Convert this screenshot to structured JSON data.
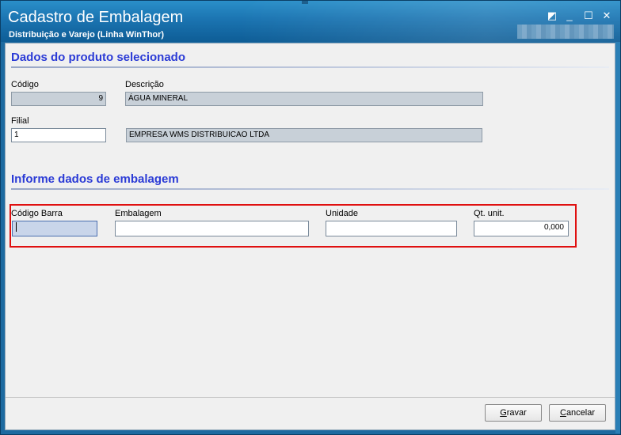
{
  "window": {
    "title": "Cadastro de Embalagem",
    "subtitle": "Distribuição e Varejo (Linha WinThor)",
    "controls": {
      "restore": "◩",
      "minimize": "_",
      "maximize": "☐",
      "close": "✕"
    }
  },
  "produto": {
    "section_title": "Dados do produto selecionado",
    "codigo": {
      "label": "Código",
      "value": "9"
    },
    "descricao": {
      "label": "Descrição",
      "value": "ÁGUA MINERAL"
    },
    "filial": {
      "label": "Filial",
      "value": "1",
      "name": "EMPRESA WMS DISTRIBUICAO LTDA"
    }
  },
  "embalagem": {
    "section_title": "Informe dados de embalagem",
    "codigo_barra": {
      "label": "Código Barra",
      "value": ""
    },
    "embalagem": {
      "label": "Embalagem",
      "value": ""
    },
    "unidade": {
      "label": "Unidade",
      "value": ""
    },
    "qt_unit": {
      "label": "Qt. unit.",
      "value": "0,000"
    }
  },
  "buttons": {
    "gravar_first": "G",
    "gravar_rest": "ravar",
    "cancelar_first": "C",
    "cancelar_rest": "ancelar"
  },
  "colors": {
    "section_title": "#2b3bd6",
    "highlight": "#e01010",
    "titlebar": "#1b74b1"
  }
}
